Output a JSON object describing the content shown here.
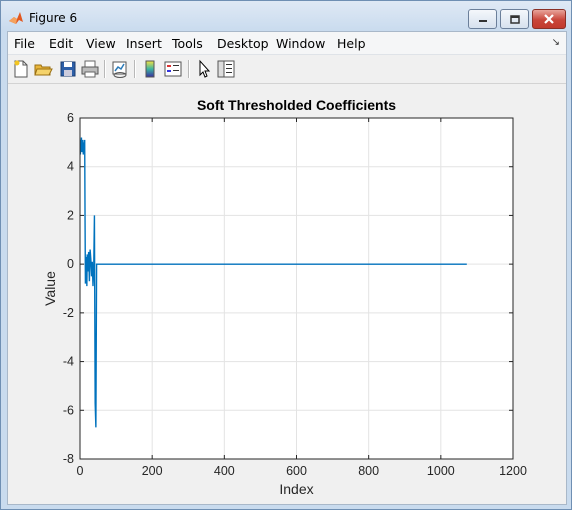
{
  "window": {
    "title": "Figure 6"
  },
  "menu": {
    "items": [
      "File",
      "Edit",
      "View",
      "Insert",
      "Tools",
      "Desktop",
      "Window",
      "Help"
    ]
  },
  "toolbar": {
    "icons": [
      "new-figure-icon",
      "open-icon",
      "save-icon",
      "print-icon",
      "link-plot-icon",
      "insert-colorbar-icon",
      "insert-legend-icon",
      "edit-plot-icon",
      "property-inspector-icon"
    ]
  },
  "colors": {
    "line": "#0072bd",
    "axes_bg": "#ffffff",
    "figure_bg": "#f0f0f0"
  },
  "chart_data": {
    "type": "line",
    "title": "Soft Thresholded Coefficients",
    "xlabel": "Index",
    "ylabel": "Value",
    "xlim": [
      0,
      1200
    ],
    "ylim": [
      -8,
      6
    ],
    "xticks": [
      0,
      200,
      400,
      600,
      800,
      1000,
      1200
    ],
    "yticks": [
      -8,
      -6,
      -4,
      -2,
      0,
      2,
      4,
      6
    ],
    "grid": true,
    "series": [
      {
        "x": [
          1,
          2,
          3,
          4,
          5,
          6,
          7,
          8,
          9,
          10,
          11,
          12,
          13,
          14,
          15,
          16,
          17,
          18,
          19,
          20,
          22,
          24,
          26,
          28,
          30,
          32,
          34,
          36,
          38,
          40,
          42,
          44,
          46,
          48,
          50,
          60,
          100,
          200,
          400,
          600,
          800,
          1000,
          1072
        ],
        "y": [
          4.5,
          5.1,
          4.7,
          5.2,
          4.6,
          5.0,
          4.8,
          5.1,
          4.5,
          4.9,
          5.0,
          4.6,
          5.1,
          1.8,
          -0.8,
          0.2,
          -0.6,
          0.3,
          -0.9,
          0.4,
          -0.3,
          0.5,
          -0.7,
          0.6,
          0.2,
          -0.5,
          0.1,
          -0.9,
          -0.2,
          2.0,
          -5.7,
          -6.7,
          0.0,
          0.0,
          0.0,
          0.0,
          0.0,
          0.0,
          0.0,
          0.0,
          0.0,
          0.0,
          0.0
        ]
      }
    ]
  }
}
